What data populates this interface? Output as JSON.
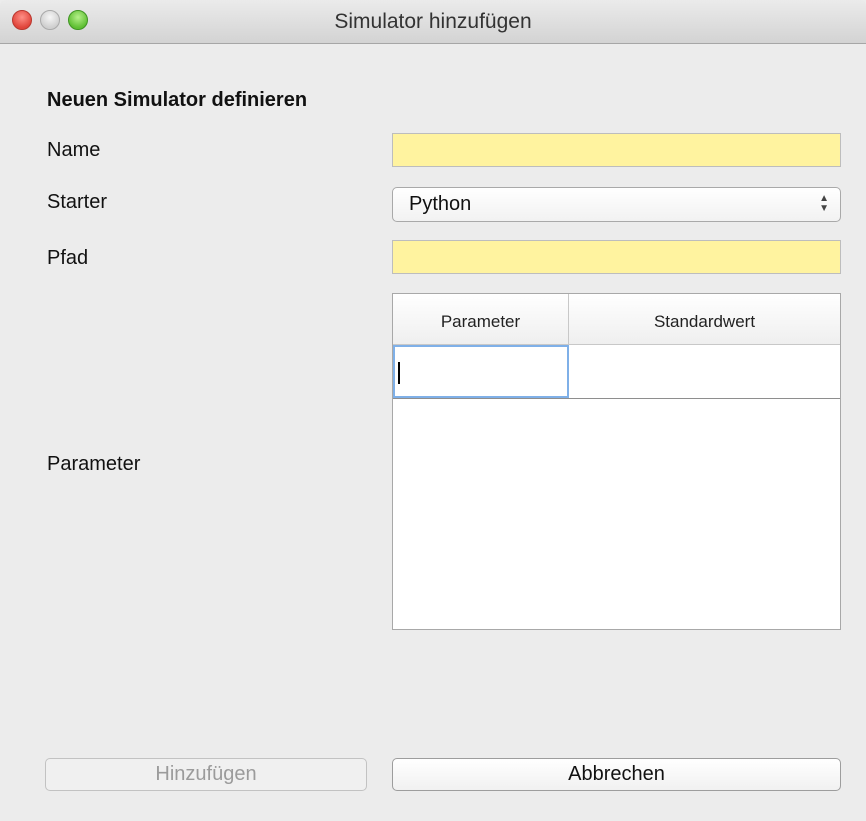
{
  "window": {
    "title": "Simulator hinzufügen"
  },
  "form": {
    "heading": "Neuen Simulator definieren",
    "name": {
      "label": "Name",
      "value": ""
    },
    "starter": {
      "label": "Starter",
      "selected": "Python"
    },
    "path": {
      "label": "Pfad",
      "value": ""
    },
    "parameters": {
      "label": "Parameter",
      "columns": [
        "Parameter",
        "Standardwert"
      ],
      "rows": [
        [
          "",
          ""
        ]
      ]
    }
  },
  "buttons": {
    "add": "Hinzufügen",
    "cancel": "Abbrechen"
  },
  "colors": {
    "required_field": "#fff39f",
    "focus_ring": "#7fb0e8"
  },
  "icons": {
    "select_arrows": "up-down-chevron-icon"
  }
}
